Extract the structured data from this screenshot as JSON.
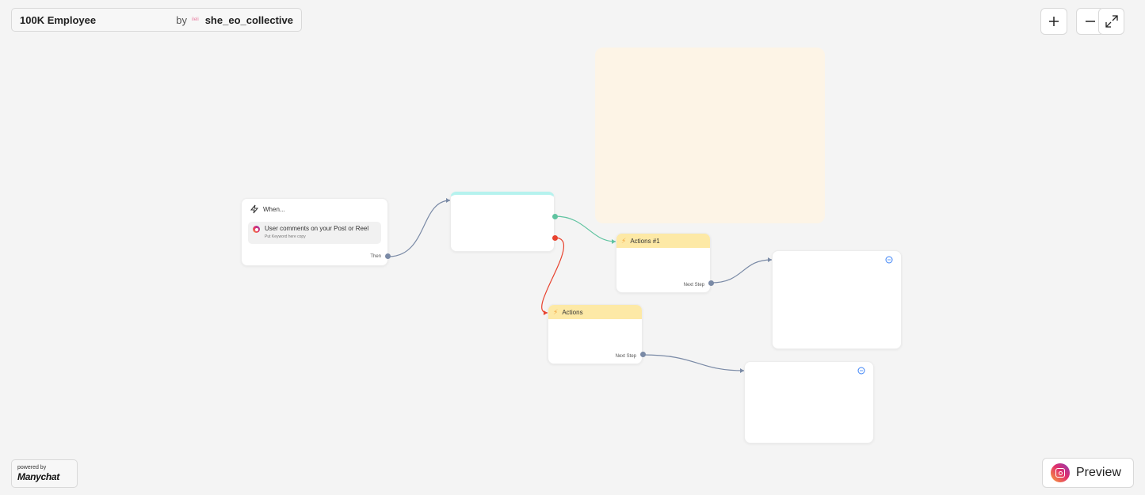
{
  "header": {
    "flow_title": "100K Employee",
    "by_label": "by",
    "author_avatar_text": "ileli",
    "author": "she_eo_collective"
  },
  "controls": {
    "zoom_in_icon": "plus-icon",
    "zoom_out_icon": "minus-icon",
    "expand_icon": "expand-icon"
  },
  "trigger": {
    "when_label": "When...",
    "condition_title": "User comments on your Post or Reel",
    "condition_sub": "Put Keyword here copy",
    "then_label": "Then"
  },
  "actions": [
    {
      "title": "Actions #1",
      "next_label": "Next Step"
    },
    {
      "title": "Actions",
      "next_label": "Next Step"
    }
  ],
  "footer": {
    "powered_by": "powered by",
    "brand": "Manychat",
    "preview_label": "Preview"
  },
  "colors": {
    "canvas": "#f4f4f4",
    "sticky": "#fdf4e6",
    "action_header": "#fde9a6",
    "condition_top": "#b5f2ee",
    "edge_default": "#7a8aa6",
    "edge_yes": "#5fc3a0",
    "edge_no": "#e8432f"
  }
}
